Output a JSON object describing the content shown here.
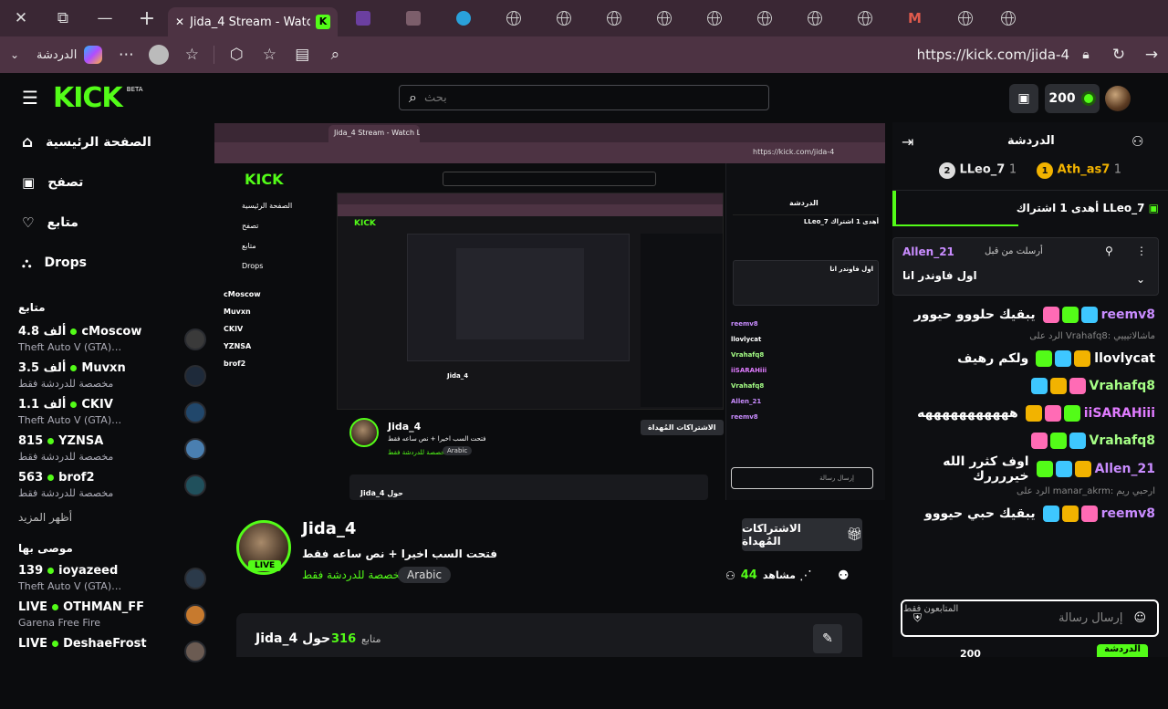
{
  "browser": {
    "active_tab_title": "Jida_4 Stream - Watch Live",
    "url": "https://kick.com/jida-4",
    "chat_label": "الدردشة"
  },
  "kick": {
    "logo": "KICK",
    "logo_beta": "BETA",
    "search_placeholder": "بحث",
    "points": "200",
    "nav": [
      {
        "label": "الصفحة الرئيسية",
        "icon": "home-icon"
      },
      {
        "label": "تصفح",
        "icon": "browse-icon"
      },
      {
        "label": "متابع",
        "icon": "heart-icon"
      },
      {
        "label": "Drops",
        "icon": "drops-icon"
      }
    ],
    "following_title": "متابع",
    "following": [
      {
        "name": "cMoscow",
        "count": "4.8 ألف",
        "sub": "Theft Auto V (GTA)…",
        "color": "#3a3a3a"
      },
      {
        "name": "Muvxn",
        "count": "3.5 ألف",
        "sub": "مخصصة للدردشة فقط",
        "color": "#1e2a3a"
      },
      {
        "name": "CKIV",
        "count": "1.1 ألف",
        "sub": "Theft Auto V (GTA)…",
        "color": "#21476b"
      },
      {
        "name": "YZNSA",
        "count": "815",
        "sub": "مخصصة للدردشة فقط",
        "color": "#4a7fb0"
      },
      {
        "name": "brof2",
        "count": "563",
        "sub": "مخصصة للدردشة فقط",
        "color": "#20505c"
      }
    ],
    "show_more": "أظهر المزيد",
    "recommended_title": "موصى بها",
    "recommended": [
      {
        "name": "ioyazeed",
        "count": "139",
        "sub": "Theft Auto V (GTA)…",
        "color": "#2b3a4a"
      },
      {
        "name": "OTHMAN_FF",
        "count": "LIVE",
        "sub": "Garena Free Fire",
        "color": "#c77a2e"
      },
      {
        "name": "DeshaeFrost",
        "count": "LIVE",
        "sub": "",
        "color": "#6b5b52"
      }
    ],
    "stream": {
      "channel": "Jida_4",
      "title": "فتحت السب اخيرا + نص ساعه فقط",
      "category": "مخصصة للدردشة فقط",
      "language": "Arabic",
      "live": "LIVE",
      "viewers": "44",
      "viewers_label": "مشاهد",
      "gift_button": "الاشتراكات المُهداة",
      "about_name": "Jida_4 حول",
      "followers": "316",
      "followers_label": "متابع"
    },
    "chat": {
      "title": "الدردشة",
      "leaders": [
        {
          "rank": "1",
          "name": "Ath_as7",
          "count": "1"
        },
        {
          "rank": "2",
          "name": "LLeo_7",
          "count": "1"
        }
      ],
      "gift_banner": "LLeo_7 أهدى 1 اشتراك",
      "pinned_label": "أرسلت من قبل",
      "pinned_user": "Allen_21",
      "pinned_text": "اول فاوندر انا",
      "messages": [
        {
          "user": "reemv8",
          "text": "يبقيك حلووو حيوور",
          "ucolor": "#c98cff",
          "reply": ""
        },
        {
          "user": "llovlycat",
          "text": "ولكم رهيف",
          "ucolor": "#ffffff",
          "reply": "الرد على Vrahafq8: ماشالاتيييي"
        },
        {
          "user": "Vrahafq8",
          "text": "",
          "ucolor": "#a6ff86",
          "reply": ""
        },
        {
          "user": "iiSARAHiii",
          "text": "هههههههههههه",
          "ucolor": "#e07bff",
          "reply": ""
        },
        {
          "user": "Vrahafq8",
          "text": "",
          "ucolor": "#a6ff86",
          "reply": ""
        },
        {
          "user": "Allen_21",
          "text": "اوف كثرر الله خيررررك",
          "ucolor": "#c98cff",
          "reply": ""
        },
        {
          "user": "reemv8",
          "text": "يبقيك حبي حيووو",
          "ucolor": "#c98cff",
          "reply": "الرد على manar_akrm: ارحبي ريم"
        }
      ],
      "followers_only": "المتابعون فقط",
      "input_placeholder": "إرسال رسالة",
      "send_button": "الدردشة",
      "footer_points": "200"
    }
  }
}
